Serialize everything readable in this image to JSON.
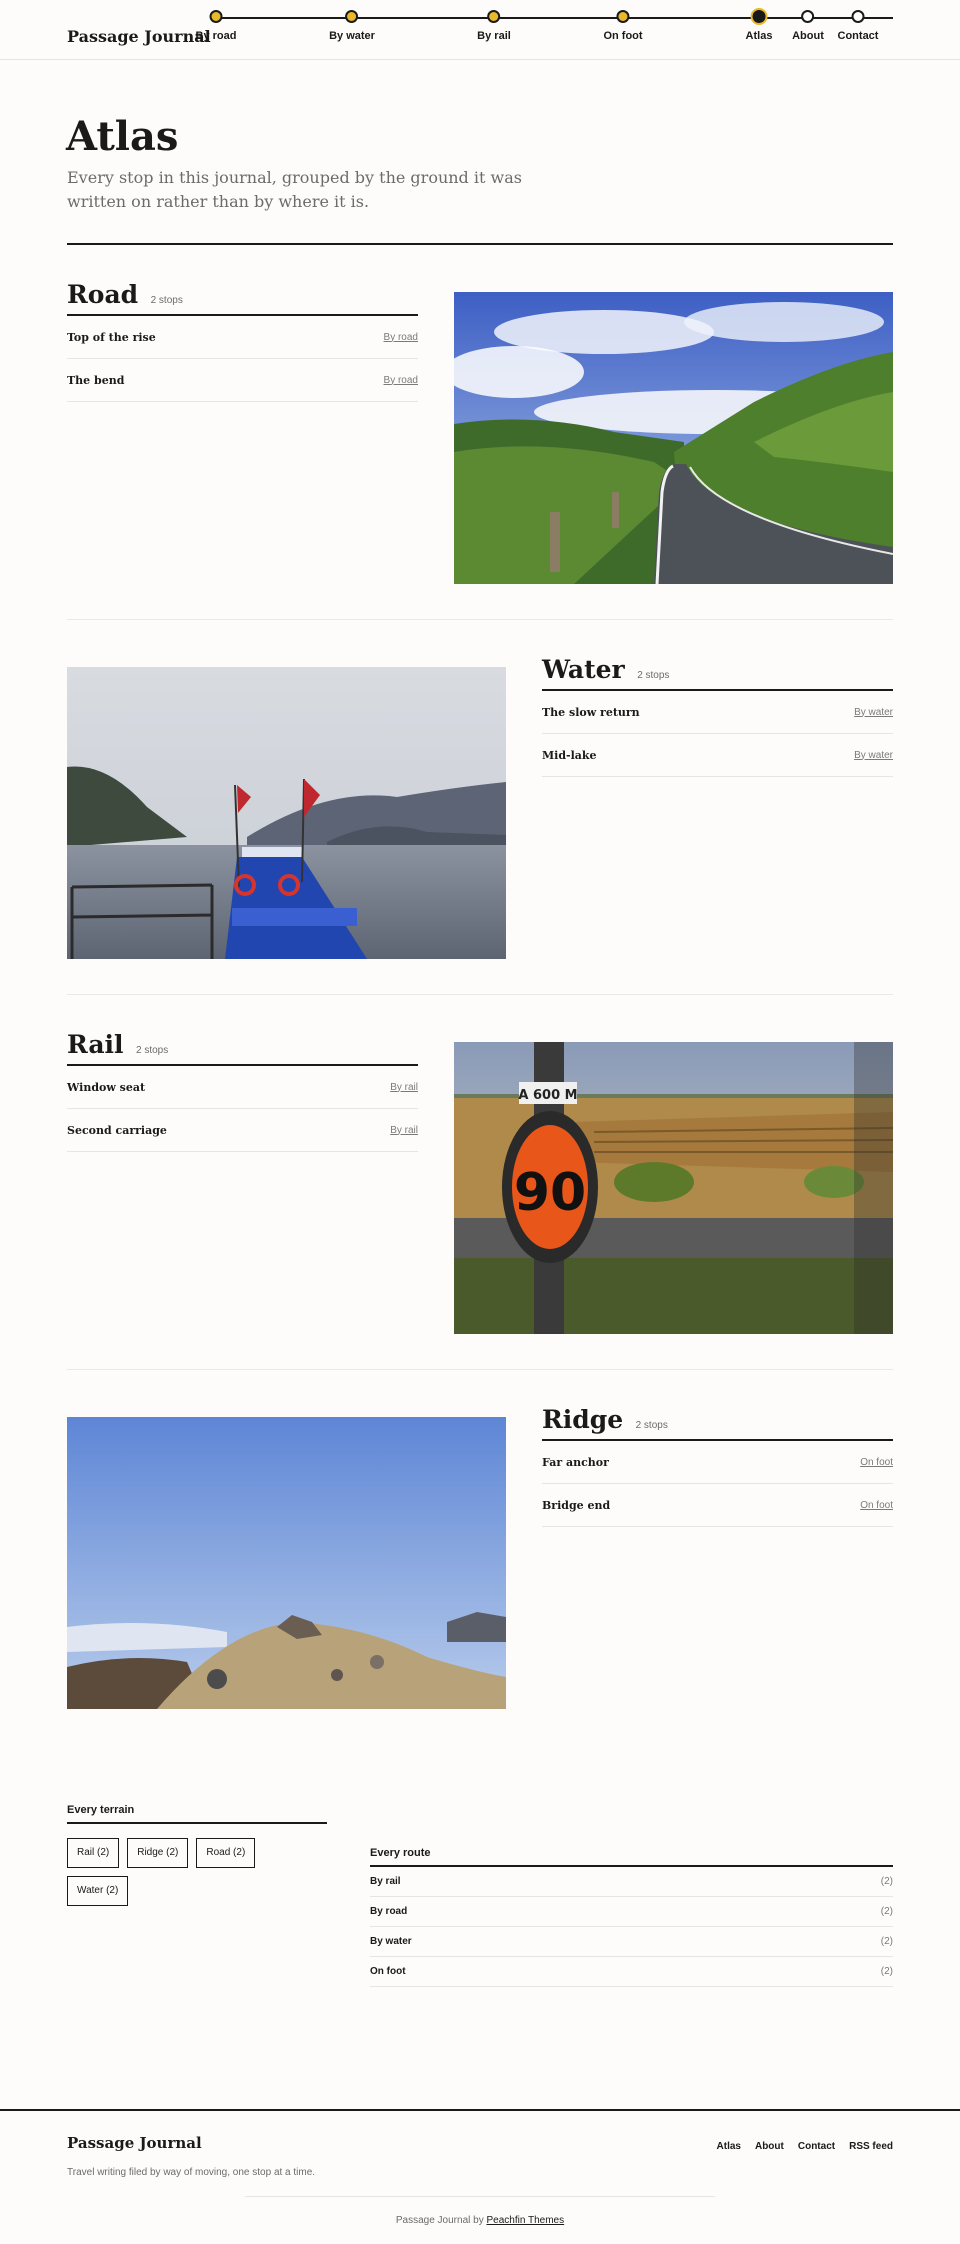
{
  "site": {
    "brand": "Passage Journal"
  },
  "nav": [
    {
      "label": "By road",
      "state": "filled"
    },
    {
      "label": "By water",
      "state": "filled"
    },
    {
      "label": "By rail",
      "state": "filled"
    },
    {
      "label": "On foot",
      "state": "filled"
    },
    {
      "label": "Atlas",
      "state": "current"
    },
    {
      "label": "About",
      "state": "empty"
    },
    {
      "label": "Contact",
      "state": "empty"
    }
  ],
  "intro": {
    "title": "Atlas",
    "subtitle": "Every stop in this journal, grouped by the ground it was written on rather than by where it is."
  },
  "terrains": [
    {
      "name": "Road",
      "count": "2 stops",
      "stops": [
        {
          "title": "Top of the rise",
          "route": "By road"
        },
        {
          "title": "The bend",
          "route": "By road"
        }
      ]
    },
    {
      "name": "Water",
      "count": "2 stops",
      "stops": [
        {
          "title": "The slow return",
          "route": "By water"
        },
        {
          "title": "Mid-lake",
          "route": "By water"
        }
      ]
    },
    {
      "name": "Rail",
      "count": "2 stops",
      "stops": [
        {
          "title": "Window seat",
          "route": "By rail"
        },
        {
          "title": "Second carriage",
          "route": "By rail"
        }
      ]
    },
    {
      "name": "Ridge",
      "count": "2 stops",
      "stops": [
        {
          "title": "Far anchor",
          "route": "On foot"
        },
        {
          "title": "Bridge end",
          "route": "On foot"
        }
      ]
    }
  ],
  "sign_text": {
    "top": "A 600 M",
    "number": "90"
  },
  "every_terrain": {
    "title": "Every terrain",
    "tags": [
      "Rail (2)",
      "Ridge (2)",
      "Road (2)",
      "Water (2)"
    ]
  },
  "every_route": {
    "title": "Every route",
    "rows": [
      {
        "name": "By rail",
        "count": "(2)"
      },
      {
        "name": "By road",
        "count": "(2)"
      },
      {
        "name": "By water",
        "count": "(2)"
      },
      {
        "name": "On foot",
        "count": "(2)"
      }
    ]
  },
  "footer": {
    "brand": "Passage Journal",
    "tagline": "Travel writing filed by way of moving, one stop at a time.",
    "nav": [
      "Atlas",
      "About",
      "Contact",
      "RSS feed"
    ],
    "credit_prefix": "Passage Journal by",
    "credit_link": "Peachfin Themes"
  },
  "colors": {
    "accent": "#e8b92a",
    "ink": "#1a1a1a",
    "muted": "#6b6b6b",
    "rule": "#e7e5e1"
  }
}
